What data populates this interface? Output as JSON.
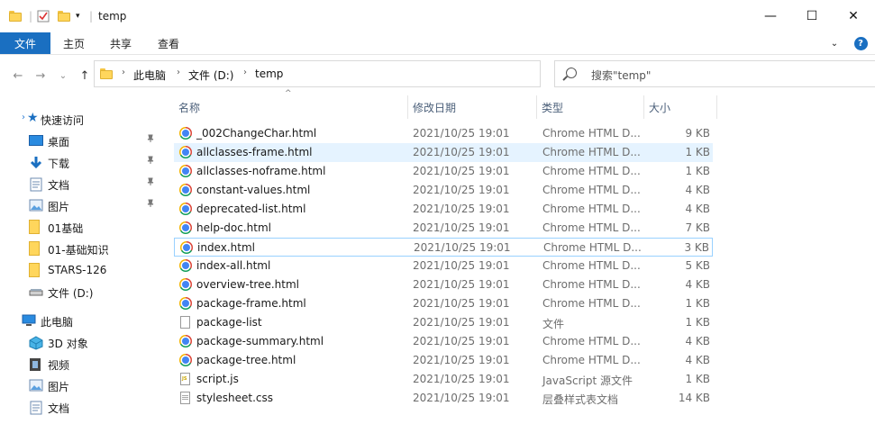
{
  "window": {
    "title": "temp",
    "quick_access_toolbar": [
      "folder-icon",
      "properties-icon",
      "new-folder-icon",
      "dropdown-arrow-icon"
    ],
    "controls": {
      "minimize": "—",
      "maximize": "☐",
      "close": "✕"
    }
  },
  "ribbon": {
    "tabs": [
      {
        "label": "文件",
        "active": true
      },
      {
        "label": "主页",
        "active": false
      },
      {
        "label": "共享",
        "active": false
      },
      {
        "label": "查看",
        "active": false
      }
    ],
    "expand_icon": "chevron-down-icon",
    "help_icon": "?"
  },
  "address": {
    "back": "←",
    "forward": "→",
    "recent": "⌄",
    "up": "↑",
    "crumbs": [
      "此电脑",
      "文件 (D:)",
      "temp"
    ],
    "separator": "›",
    "refresh": "↻",
    "search_placeholder": "搜索\"temp\""
  },
  "nav": {
    "quick_access": "快速访问",
    "items": [
      {
        "label": "桌面",
        "icon": "desktop-icon",
        "pinned": true
      },
      {
        "label": "下载",
        "icon": "download-icon",
        "pinned": true
      },
      {
        "label": "文档",
        "icon": "document-icon",
        "pinned": true
      },
      {
        "label": "图片",
        "icon": "picture-icon",
        "pinned": true
      },
      {
        "label": "01基础",
        "icon": "folder-icon",
        "pinned": false
      },
      {
        "label": "01-基础知识",
        "icon": "folder-icon",
        "pinned": false
      },
      {
        "label": "STARS-126",
        "icon": "folder-icon",
        "pinned": false
      },
      {
        "label": "文件 (D:)",
        "icon": "drive-icon",
        "pinned": false
      }
    ],
    "this_pc": "此电脑",
    "pc_items": [
      {
        "label": "3D 对象",
        "icon": "3d-objects-icon"
      },
      {
        "label": "视频",
        "icon": "video-icon"
      },
      {
        "label": "图片",
        "icon": "picture-icon"
      },
      {
        "label": "文档",
        "icon": "document-icon"
      }
    ],
    "pin_glyph": "📌"
  },
  "columns": {
    "name": "名称",
    "date": "修改日期",
    "type": "类型",
    "size": "大小",
    "sort_glyph": "^"
  },
  "files": [
    {
      "name": "_002ChangeChar.html",
      "date": "2021/10/25 19:01",
      "type": "Chrome HTML D...",
      "size": "9 KB",
      "icon": "chrome-icon"
    },
    {
      "name": "allclasses-frame.html",
      "date": "2021/10/25 19:01",
      "type": "Chrome HTML D...",
      "size": "1 KB",
      "icon": "chrome-icon"
    },
    {
      "name": "allclasses-noframe.html",
      "date": "2021/10/25 19:01",
      "type": "Chrome HTML D...",
      "size": "1 KB",
      "icon": "chrome-icon"
    },
    {
      "name": "constant-values.html",
      "date": "2021/10/25 19:01",
      "type": "Chrome HTML D...",
      "size": "4 KB",
      "icon": "chrome-icon"
    },
    {
      "name": "deprecated-list.html",
      "date": "2021/10/25 19:01",
      "type": "Chrome HTML D...",
      "size": "4 KB",
      "icon": "chrome-icon"
    },
    {
      "name": "help-doc.html",
      "date": "2021/10/25 19:01",
      "type": "Chrome HTML D...",
      "size": "7 KB",
      "icon": "chrome-icon"
    },
    {
      "name": "index.html",
      "date": "2021/10/25 19:01",
      "type": "Chrome HTML D...",
      "size": "3 KB",
      "icon": "chrome-icon"
    },
    {
      "name": "index-all.html",
      "date": "2021/10/25 19:01",
      "type": "Chrome HTML D...",
      "size": "5 KB",
      "icon": "chrome-icon"
    },
    {
      "name": "overview-tree.html",
      "date": "2021/10/25 19:01",
      "type": "Chrome HTML D...",
      "size": "4 KB",
      "icon": "chrome-icon"
    },
    {
      "name": "package-frame.html",
      "date": "2021/10/25 19:01",
      "type": "Chrome HTML D...",
      "size": "1 KB",
      "icon": "chrome-icon"
    },
    {
      "name": "package-list",
      "date": "2021/10/25 19:01",
      "type": "文件",
      "size": "1 KB",
      "icon": "file-icon"
    },
    {
      "name": "package-summary.html",
      "date": "2021/10/25 19:01",
      "type": "Chrome HTML D...",
      "size": "4 KB",
      "icon": "chrome-icon"
    },
    {
      "name": "package-tree.html",
      "date": "2021/10/25 19:01",
      "type": "Chrome HTML D...",
      "size": "4 KB",
      "icon": "chrome-icon"
    },
    {
      "name": "script.js",
      "date": "2021/10/25 19:01",
      "type": "JavaScript 源文件",
      "size": "1 KB",
      "icon": "js-file-icon"
    },
    {
      "name": "stylesheet.css",
      "date": "2021/10/25 19:01",
      "type": "层叠样式表文档",
      "size": "14 KB",
      "icon": "css-file-icon"
    }
  ],
  "hover_row": "allclasses-frame.html",
  "focused_row": "index.html",
  "colors": {
    "accent": "#1a6fc1",
    "hover": "#e5f3ff",
    "focus_border": "#99d1ff",
    "folder": "#ffd65c"
  }
}
